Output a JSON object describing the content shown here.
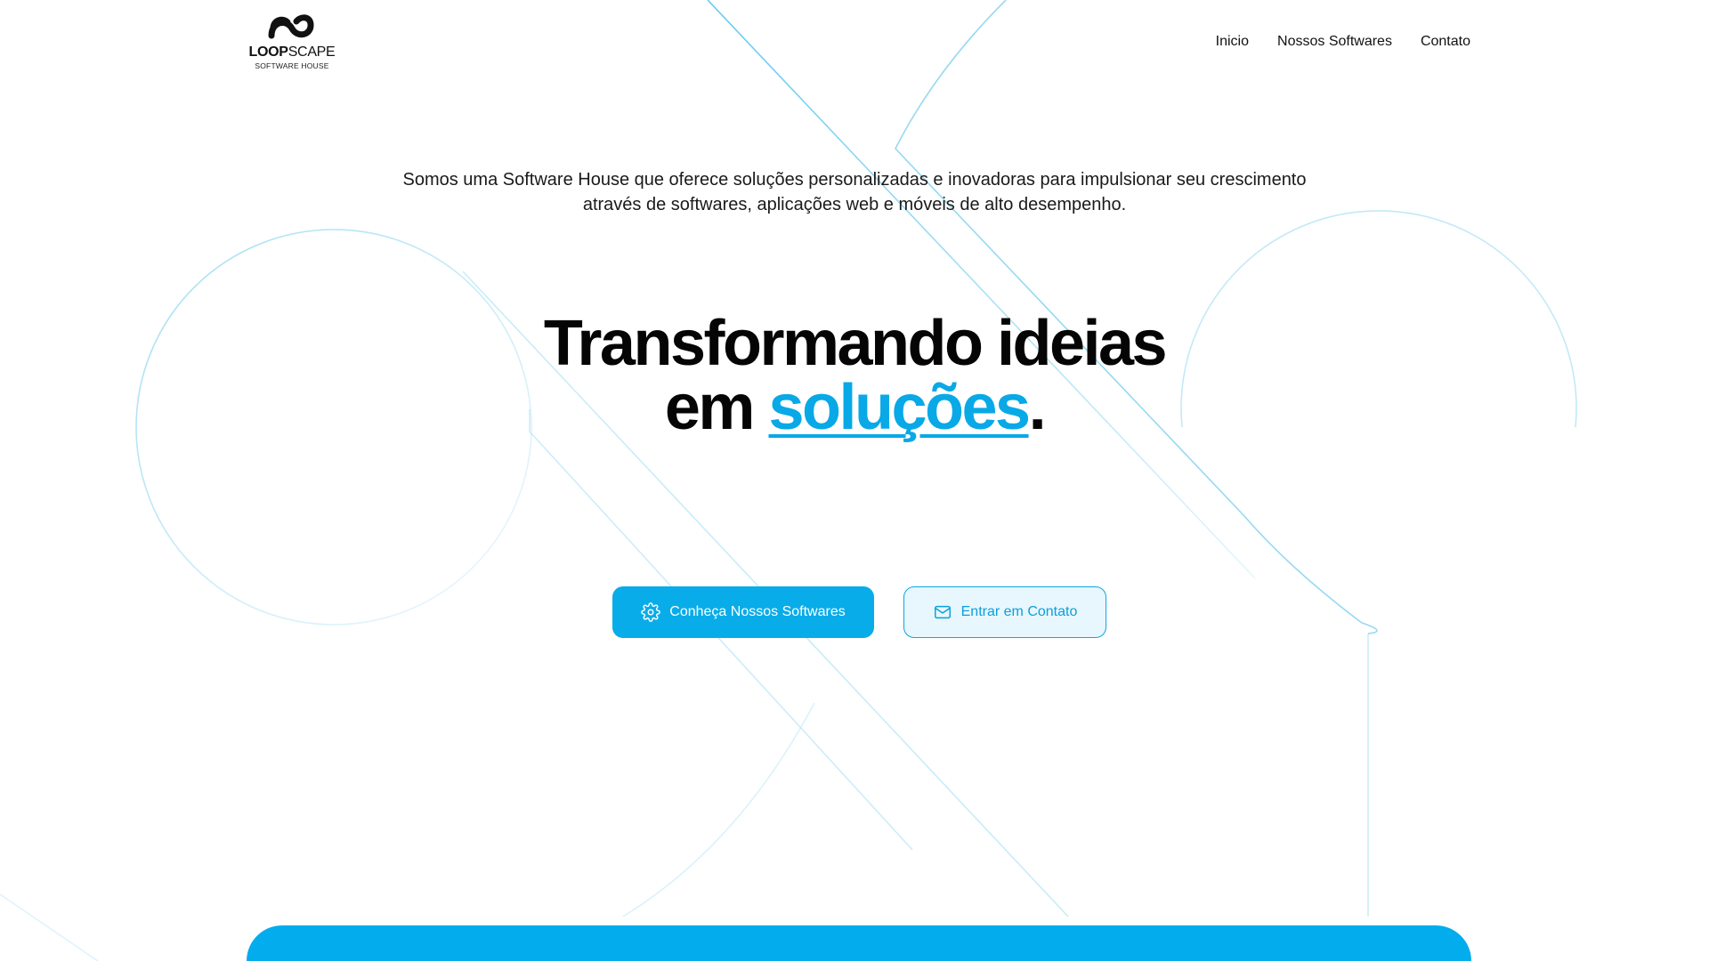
{
  "brand": {
    "name_bold": "LOOP",
    "name_light": "SCAPE",
    "tagline": "SOFTWARE HOUSE"
  },
  "nav": {
    "items": [
      {
        "label": "Inicio"
      },
      {
        "label": "Nossos Softwares"
      },
      {
        "label": "Contato"
      }
    ]
  },
  "hero": {
    "headline_line1": "Transformando ideias",
    "headline_line2_prefix": "em ",
    "headline_accent": "soluções",
    "headline_suffix": ".",
    "subtitle": "Somos uma Software House que oferece soluções personalizadas e inovadoras para impulsionar seu crescimento através de softwares, aplicações web e móveis de alto desempenho."
  },
  "actions": {
    "primary": {
      "label": "Conheça Nossos Softwares",
      "icon": "gear-icon"
    },
    "secondary": {
      "label": "Entrar em Contato",
      "icon": "mail-icon"
    }
  },
  "colors": {
    "accent": "#08ace9",
    "text": "#0a0a0a",
    "background": "#ffffff",
    "line_art": "#8fd6f2"
  }
}
